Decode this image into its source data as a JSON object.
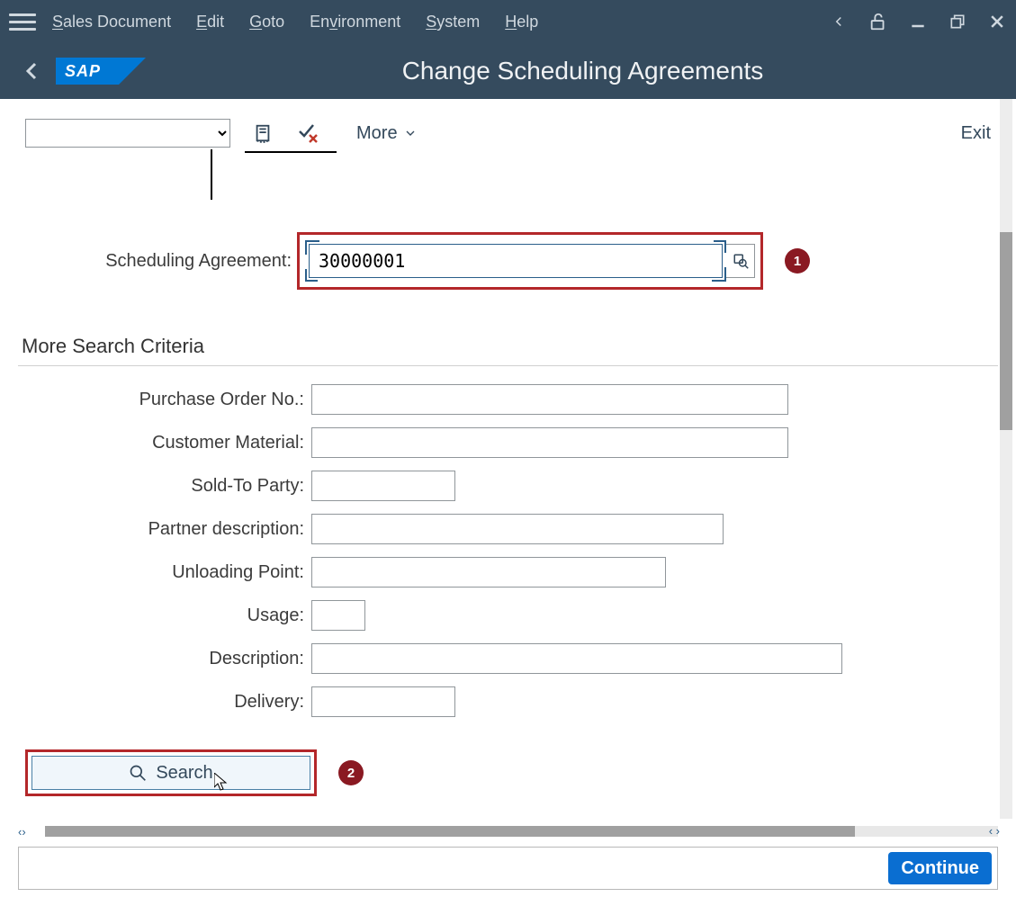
{
  "menubar": {
    "items": [
      {
        "key": "S",
        "rest": "ales Document"
      },
      {
        "key": "E",
        "rest": "dit"
      },
      {
        "key": "G",
        "rest": "oto"
      },
      {
        "key": "",
        "pre": "En",
        "key2": "v",
        "rest": "ironment"
      },
      {
        "key": "",
        "pre": "",
        "key2": "S",
        "rest": "ystem"
      },
      {
        "key": "H",
        "rest": "elp"
      }
    ]
  },
  "page_title": "Change Scheduling Agreements",
  "toolbar": {
    "more_label": "More",
    "exit_label": "Exit"
  },
  "sa": {
    "label": "Scheduling Agreement:",
    "value": "30000001",
    "badge": "1"
  },
  "section_title": "More Search Criteria",
  "criteria": {
    "po_label": "Purchase Order No.:",
    "po_value": "",
    "cm_label": "Customer Material:",
    "cm_value": "",
    "sold_label": "Sold-To Party:",
    "sold_value": "",
    "pd_label": "Partner description:",
    "pd_value": "",
    "ul_label": "Unloading Point:",
    "ul_value": "",
    "usage_label": "Usage:",
    "usage_value": "",
    "desc_label": "Description:",
    "desc_value": "",
    "deliv_label": "Delivery:",
    "deliv_value": ""
  },
  "search": {
    "label": "Search",
    "badge": "2"
  },
  "footer": {
    "continue_label": "Continue"
  },
  "logo_text": "SAP"
}
